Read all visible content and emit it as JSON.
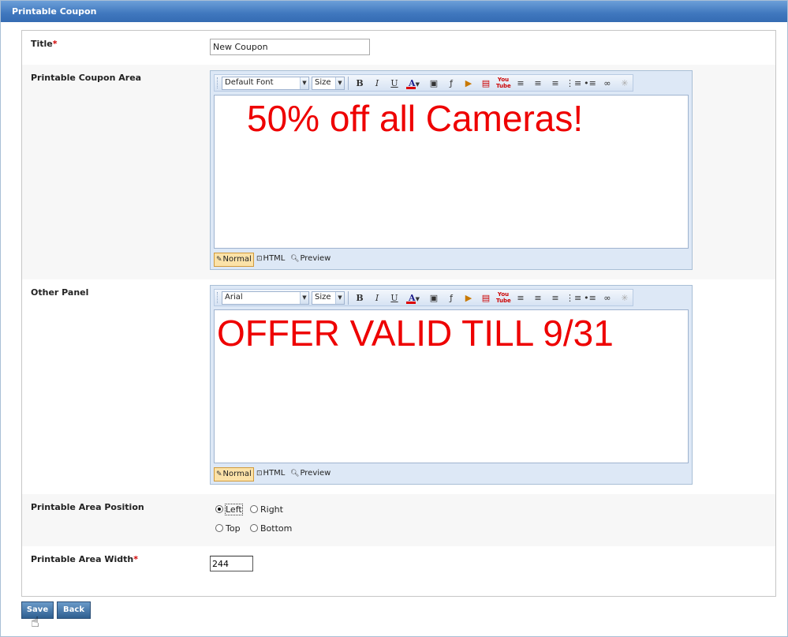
{
  "header": {
    "title": "Printable Coupon"
  },
  "form": {
    "title": {
      "label": "Title",
      "required_mark": "*",
      "value": "New Coupon"
    },
    "coupon_area": {
      "label": "Printable Coupon Area",
      "font_select": "Default Font",
      "size_select": "Size",
      "content": "50% off all Cameras!"
    },
    "other_panel": {
      "label": "Other Panel",
      "font_select": "Arial",
      "size_select": "Size",
      "content": "OFFER VALID TILL 9/31"
    },
    "editor_modes": {
      "normal": "Normal",
      "html": "HTML",
      "preview": "Preview"
    },
    "position": {
      "label": "Printable Area Position",
      "options": {
        "left": "Left",
        "right": "Right",
        "top": "Top",
        "bottom": "Bottom"
      },
      "selected": "Left"
    },
    "width": {
      "label": "Printable Area Width",
      "required_mark": "*",
      "value": "244"
    }
  },
  "buttons": {
    "save": "Save",
    "back": "Back"
  },
  "colors": {
    "header": "#3f77be",
    "editor_text": "#ee0000",
    "required": "#d00000",
    "button": "#2f5f90"
  }
}
